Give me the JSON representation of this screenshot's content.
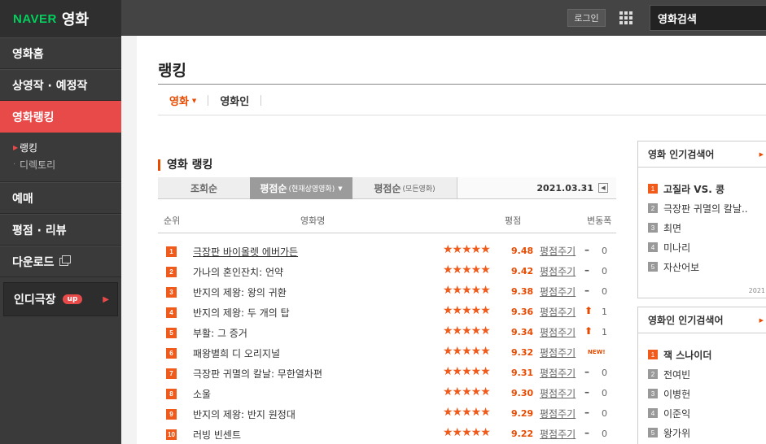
{
  "logo": {
    "brand": "NAVER",
    "service": "영화"
  },
  "sidebar": {
    "items": [
      {
        "label": "영화홈"
      },
      {
        "label": "상영작 · 예정작"
      },
      {
        "label": "영화랭킹"
      }
    ],
    "subitems": [
      {
        "label": "랭킹"
      },
      {
        "label": "디렉토리"
      }
    ],
    "items2": [
      {
        "label": "예매"
      },
      {
        "label": "평점 · 리뷰"
      },
      {
        "label": "다운로드"
      }
    ],
    "indie": {
      "label": "인디극장",
      "badge": "up"
    }
  },
  "topbar": {
    "login_label": "로그인",
    "search_value": "영화검색"
  },
  "main": {
    "page_title": "랭킹",
    "tabs": [
      {
        "label": "영화"
      },
      {
        "label": "영화인"
      }
    ],
    "section_title": "영화 랭킹",
    "sort_tabs": [
      {
        "label": "조회순",
        "sub": ""
      },
      {
        "label": "평점순",
        "sub": "(현재상영영화)"
      },
      {
        "label": "평점순",
        "sub": "(모든영화)"
      }
    ],
    "date": "2021.03.31",
    "columns": {
      "rank": "순위",
      "title": "영화명",
      "rating": "평점",
      "change": "변동폭"
    },
    "rate_label": "평점주기",
    "rows": [
      {
        "rank": "1",
        "title": "극장판 바이올렛 에버가든",
        "score": "9.48",
        "change_icon": "–",
        "change": "0"
      },
      {
        "rank": "2",
        "title": "가나의 혼인잔치: 언약",
        "score": "9.42",
        "change_icon": "–",
        "change": "0"
      },
      {
        "rank": "3",
        "title": "반지의 제왕: 왕의 귀환",
        "score": "9.38",
        "change_icon": "–",
        "change": "0"
      },
      {
        "rank": "4",
        "title": "반지의 제왕: 두 개의 탑",
        "score": "9.36",
        "change_icon": "⬆",
        "change": "1"
      },
      {
        "rank": "5",
        "title": "부활: 그 증거",
        "score": "9.34",
        "change_icon": "⬆",
        "change": "1"
      },
      {
        "rank": "6",
        "title": "패왕별희 디 오리지널",
        "score": "9.32",
        "change_icon": "NEW!",
        "change": ""
      },
      {
        "rank": "7",
        "title": "극장판 귀멸의 칼날: 무한열차편",
        "score": "9.31",
        "change_icon": "–",
        "change": "0"
      },
      {
        "rank": "8",
        "title": "소울",
        "score": "9.30",
        "change_icon": "–",
        "change": "0"
      },
      {
        "rank": "9",
        "title": "반지의 제왕: 반지 원정대",
        "score": "9.29",
        "change_icon": "–",
        "change": "0"
      },
      {
        "rank": "10",
        "title": "러빙 빈센트",
        "score": "9.22",
        "change_icon": "–",
        "change": "0"
      }
    ]
  },
  "panels": {
    "movie": {
      "title": "영화 인기검색어",
      "items": [
        "고질라 VS. 콩",
        "극장판 귀멸의 칼날..",
        "최면",
        "미나리",
        "자산어보"
      ],
      "date": "2021"
    },
    "person": {
      "title": "영화인 인기검색어",
      "items": [
        "잭 스나이더",
        "전여빈",
        "이병헌",
        "이준익",
        "왕가위"
      ]
    }
  },
  "colors": {
    "accent": "#f05a1a",
    "active_nav": "#e84a4a",
    "naver_green": "#03cf5d"
  }
}
